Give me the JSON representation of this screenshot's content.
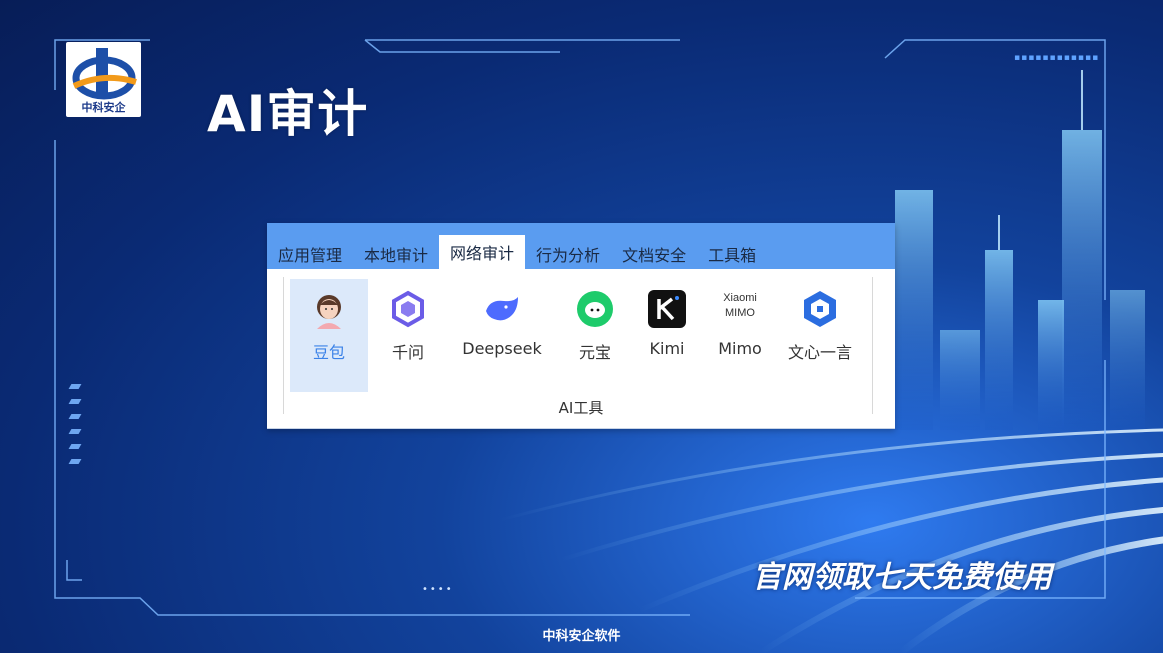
{
  "slide": {
    "title": "AI审计",
    "logo_caption": "中科安企",
    "tagline": "官网领取七天免费使用",
    "footer": "中科安企软件"
  },
  "ribbon": {
    "tabs": [
      {
        "label": "应用管理",
        "active": false
      },
      {
        "label": "本地审计",
        "active": false
      },
      {
        "label": "网络审计",
        "active": true
      },
      {
        "label": "行为分析",
        "active": false
      },
      {
        "label": "文档安全",
        "active": false
      },
      {
        "label": "工具箱",
        "active": false
      }
    ],
    "group_label": "AI工具",
    "tools": [
      {
        "label": "豆包",
        "icon": "doubao-icon",
        "selected": true
      },
      {
        "label": "千问",
        "icon": "qianwen-icon",
        "selected": false
      },
      {
        "label": "Deepseek",
        "icon": "deepseek-icon",
        "selected": false
      },
      {
        "label": "元宝",
        "icon": "yuanbao-icon",
        "selected": false
      },
      {
        "label": "Kimi",
        "icon": "kimi-icon",
        "selected": false
      },
      {
        "label": "Mimo",
        "icon": "mimo-icon",
        "icon_text": "Xiaomi MIMO",
        "selected": false
      },
      {
        "label": "文心一言",
        "icon": "wenxin-icon",
        "selected": false
      }
    ]
  },
  "colors": {
    "tabbar": "#5a9cf0",
    "selected_tool_bg": "#dce9fa",
    "selected_tool_text": "#3b82e8",
    "background": "#0a2a74"
  }
}
